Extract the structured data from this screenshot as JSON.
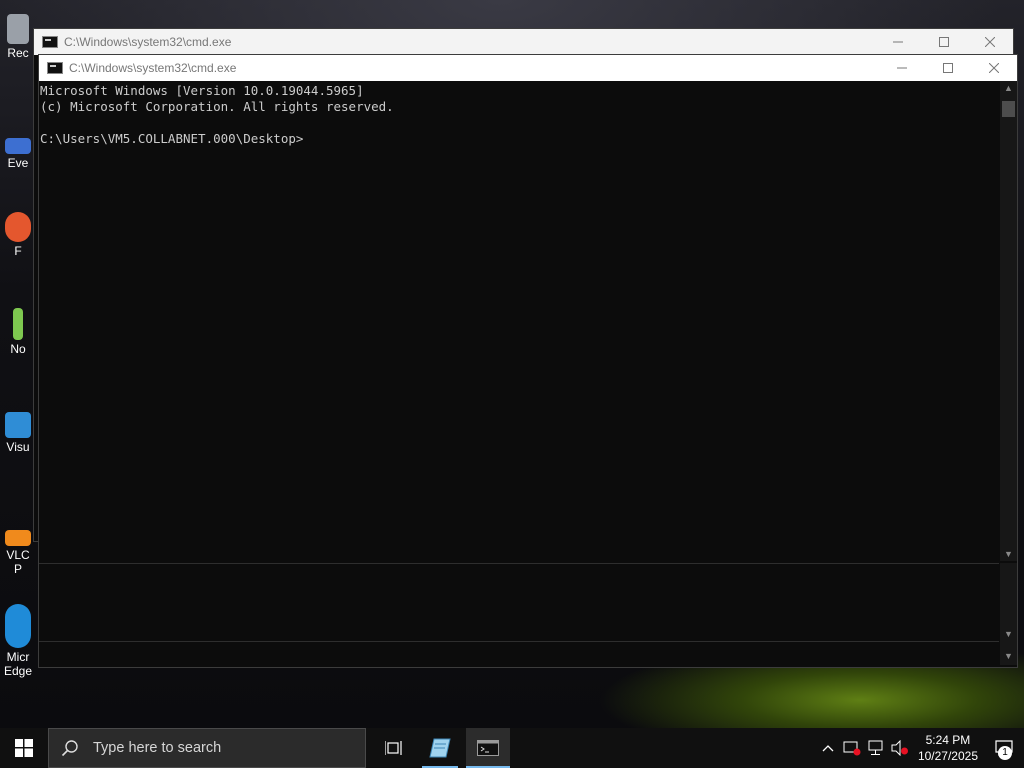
{
  "desktop": {
    "icons": [
      {
        "label": "Rec",
        "color": "#9aa0a8"
      },
      {
        "label": "Eve",
        "color": "#3d6fd1"
      },
      {
        "label": "F",
        "color": "#e4572e"
      },
      {
        "label": "No",
        "color": "#7ec850"
      },
      {
        "label": "Visu",
        "color": "#2f8dd6"
      },
      {
        "label": "VLC",
        "color": "#f08a1c"
      },
      {
        "label": "P",
        "color": "#f08a1c"
      },
      {
        "label": "Micr",
        "color": "#1f8bd8"
      },
      {
        "label": "Edge",
        "color": "#1f8bd8"
      }
    ]
  },
  "back_window": {
    "title": "C:\\Windows\\system32\\cmd.exe",
    "minimize_glyph": "—",
    "maximize_glyph": "☐",
    "close_glyph": "✕"
  },
  "front_window": {
    "title": "C:\\Windows\\system32\\cmd.exe",
    "console_lines": [
      "Microsoft Windows [Version 10.0.19044.5965]",
      "(c) Microsoft Corporation. All rights reserved.",
      "",
      "C:\\Users\\VM5.COLLABNET.000\\Desktop>"
    ]
  },
  "taskbar": {
    "search_placeholder": "Type here to search",
    "clock_time": "5:24 PM",
    "clock_date": "10/27/2025",
    "notification_count": "1",
    "accent_color": "#76b9ed"
  }
}
